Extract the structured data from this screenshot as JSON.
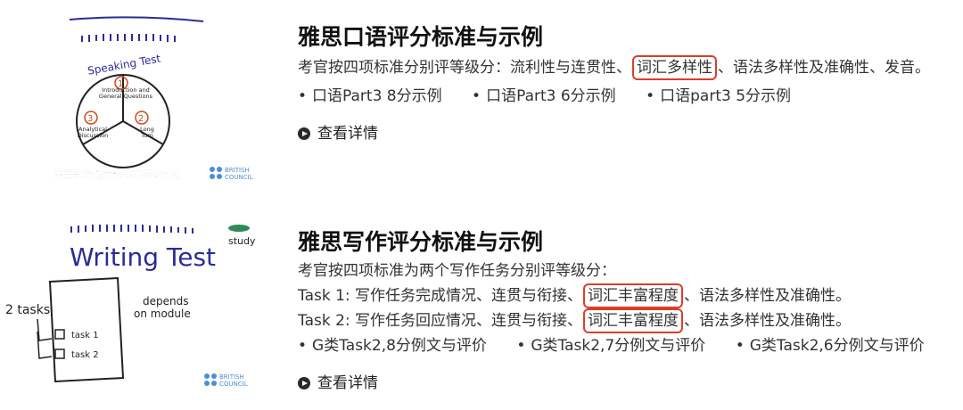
{
  "cards": [
    {
      "title": "雅思口语评分标准与示例",
      "desc_before": "考官按四项标准分别评等级分：流利性与连贯性、",
      "desc_highlight": "词汇多样性",
      "desc_after": "、语法多样性及准确性、发音。",
      "links": [
        "口语Part3 8分示例",
        "口语Part3 6分示例",
        "口语part3 5分示例"
      ],
      "more_label": "查看详情",
      "thumb": {
        "heading": "Speaking Test",
        "step1": "Introduction and General Questions",
        "step2": "Long Turn",
        "step3": "Analytical Discussion",
        "caption": "第三部分是分析性的问答讨论",
        "brand_line1": "BRITISH",
        "brand_line2": "COUNCIL"
      }
    },
    {
      "title": "雅思写作评分标准与示例",
      "desc": "考官按四项标准为两个写作任务分别评等级分：",
      "task_lines": [
        {
          "before": "Task 1: 写作任务完成情况、连贯与衔接、",
          "highlight": "词汇丰富程度",
          "after": "、语法多样性及准确性。"
        },
        {
          "before": "Task 2: 写作任务回应情况、连贯与衔接、",
          "highlight": "词汇丰富程度",
          "after": "、语法多样性及准确性。"
        }
      ],
      "links": [
        "G类Task2,8分例文与评价",
        "G类Task2,7分例文与评价",
        "G类Task2,6分例文与评价"
      ],
      "more_label": "查看详情",
      "thumb": {
        "heading": "Writing Test",
        "corner": "study",
        "tasks_label": "2 tasks",
        "task1": "task 1",
        "task2": "task 2",
        "depends": "depends",
        "on_module": "on module",
        "brand_line1": "BRITISH",
        "brand_line2": "COUNCIL"
      }
    }
  ],
  "colors": {
    "highlight_border": "#e03c2a",
    "title": "#111111",
    "text": "#333333"
  },
  "icons": {
    "more": "play-circle-icon",
    "bullet": "•"
  }
}
